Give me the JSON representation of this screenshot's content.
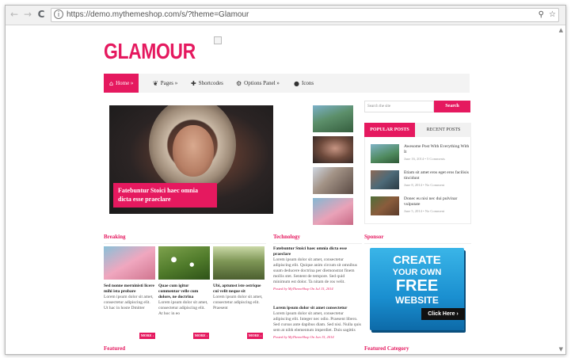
{
  "browser": {
    "url": "https://demo.mythemeshop.com/s/?theme=Glamour",
    "back_icon": "←",
    "forward_icon": "→",
    "reload_icon": "C",
    "info_icon": "i",
    "zoom_icon": "⚲",
    "star_icon": "☆"
  },
  "site": {
    "logo": "GLAMOUR",
    "accent_color": "#e5195f"
  },
  "nav": [
    {
      "label": "Home »",
      "icon": "home-icon"
    },
    {
      "label": "Pages »",
      "icon": "leaf-icon"
    },
    {
      "label": "Shortcodes",
      "icon": "plus-icon"
    },
    {
      "label": "Options Panel »",
      "icon": "gear-icon"
    },
    {
      "label": "Icons",
      "icon": "apple-icon"
    }
  ],
  "slider": {
    "caption": "Fatebuntur Stoici haec omnia dicta esse praeclare"
  },
  "sidebar": {
    "search_placeholder": "Search the site",
    "search_button": "Search",
    "tabs": [
      "POPULAR POSTS",
      "RECENT POSTS"
    ],
    "posts": [
      {
        "title": "Awesome Post With Everything With It",
        "meta": "June 16, 2014 • 5 Comments"
      },
      {
        "title": "Etiam sit amet eros eget eros facilisis tincidunt",
        "meta": "June 8, 2014 • No Comment"
      },
      {
        "title": "Donec eu nisi nec dui pulvinar vulputate",
        "meta": "June 5, 2014 • No Comment"
      }
    ]
  },
  "breaking": {
    "heading": "Breaking",
    "more_label": "MORE ›",
    "cards": [
      {
        "title": "Sed nonne merninisti licere mihi ista probare",
        "excerpt": "Lorem ipsum dolor sit amet, consectetur adipiscing elit. Ut hac in hoste Dmitter"
      },
      {
        "title": "Quae cum igitur commentar velle cum dolore, ne doctrina",
        "excerpt": "Lorem ipsum dolor sit amet, consectetur adipiscing elit. At hoc in eo"
      },
      {
        "title": "Ubi, aptumst iste ostrique cui velit neque sit",
        "excerpt": "Lorem ipsum dolor sit amet, consectetur adipiscing elit. Praesent"
      }
    ]
  },
  "technology": {
    "heading": "Technology",
    "posts": [
      {
        "title": "Fatebuntur Stoici haec omnia dicta esse praeclare",
        "excerpt": "Lorem ipsum dolor sit amet, consectetur adipiscing elit. Quique anim circum sit omnibus suum deducere doctrina per diemonstrat finem mollis stet. Sentent de tempore. Sed quid minimum est dolor. Ta nitam de ros velit.",
        "meta": "Posted by MyThemeShop On Jul 15, 2014"
      },
      {
        "title": "Lorem ipsum dolor sit amet consectetur",
        "excerpt": "Lorem ipsum dolor sit amet, consectetur adipiscing elit. Integer nec odio. Praesent libero. Sed cursus ante dapibus diam. Sed nisi. Nulla quis sem at nibh elementum imperdiet. Duis sagittis",
        "meta": "Posted by MyThemeShop On Jun 15, 2014"
      }
    ]
  },
  "sponsor": {
    "heading": "Sponsor",
    "ad_lines": [
      "CREATE",
      "YOUR OWN",
      "FREE",
      "WEBSITE"
    ],
    "ad_button": "Click Here ›"
  },
  "featured": {
    "heading": "Featured"
  },
  "featured_category": {
    "heading": "Featured Category"
  }
}
